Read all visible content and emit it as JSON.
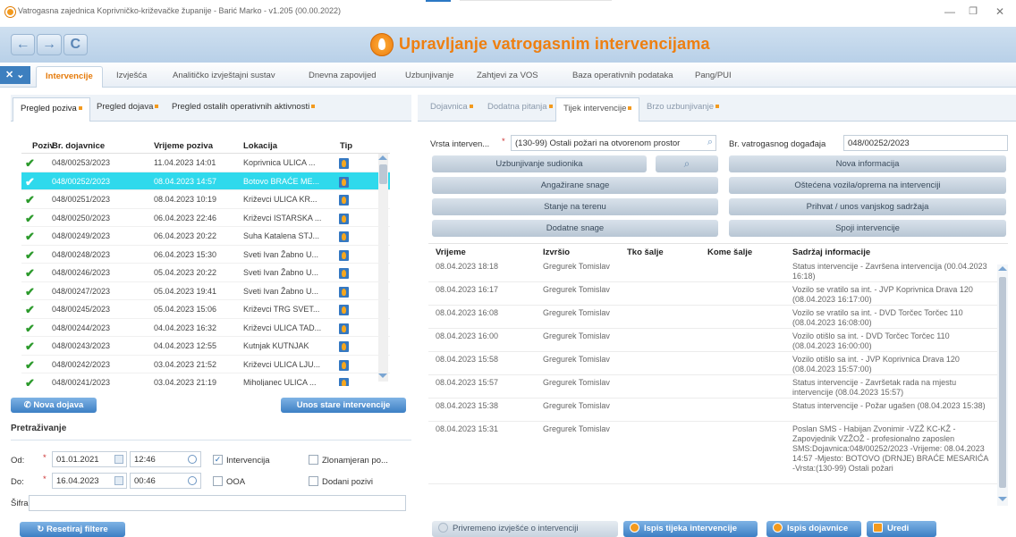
{
  "window": {
    "title": "Vatrogasna zajednica Koprivničko-križevačke županije - Barić Marko - v1.205 (00.00.2022)"
  },
  "header": {
    "app_title": "Upravljanje vatrogasnim intervencijama",
    "nav": [
      "←",
      "→",
      "C"
    ]
  },
  "menu": {
    "items": [
      "Intervencije",
      "Izvješća",
      "Analitičko izvještajni sustav",
      "Dnevna zapovijed",
      "Uzbunjivanje",
      "Zahtjevi za VOS",
      "Baza operativnih podataka",
      "Pang/PUI"
    ]
  },
  "left": {
    "tabs": [
      "Pregled poziva",
      "Pregled dojava",
      "Pregled ostalih operativnih aktivnosti"
    ],
    "columns": [
      "Poziv",
      "Br. dojavnice",
      "Vrijeme poziva",
      "Lokacija",
      "Tip"
    ],
    "rows": [
      {
        "broj": "048/00253/2023",
        "vrijeme": "11.04.2023 14:01",
        "lokacija": "Koprivnica ULICA ..."
      },
      {
        "broj": "048/00252/2023",
        "vrijeme": "08.04.2023 14:57",
        "lokacija": "Botovo BRAĆE ME..."
      },
      {
        "broj": "048/00251/2023",
        "vrijeme": "08.04.2023 10:19",
        "lokacija": "Križevci ULICA KR..."
      },
      {
        "broj": "048/00250/2023",
        "vrijeme": "06.04.2023 22:46",
        "lokacija": "Križevci ISTARSKA ..."
      },
      {
        "broj": "048/00249/2023",
        "vrijeme": "06.04.2023 20:22",
        "lokacija": "Suha Katalena STJ..."
      },
      {
        "broj": "048/00248/2023",
        "vrijeme": "06.04.2023 15:30",
        "lokacija": "Sveti Ivan Žabno U..."
      },
      {
        "broj": "048/00246/2023",
        "vrijeme": "05.04.2023 20:22",
        "lokacija": "Sveti Ivan Žabno U..."
      },
      {
        "broj": "048/00247/2023",
        "vrijeme": "05.04.2023 19:41",
        "lokacija": "Sveti Ivan Žabno U..."
      },
      {
        "broj": "048/00245/2023",
        "vrijeme": "05.04.2023 15:06",
        "lokacija": "Križevci TRG SVET..."
      },
      {
        "broj": "048/00244/2023",
        "vrijeme": "04.04.2023 16:32",
        "lokacija": "Križevci ULICA TAD..."
      },
      {
        "broj": "048/00243/2023",
        "vrijeme": "04.04.2023 12:55",
        "lokacija": "Kutnjak KUTNJAK"
      },
      {
        "broj": "048/00242/2023",
        "vrijeme": "03.04.2023 21:52",
        "lokacija": "Križevci ULICA LJU..."
      },
      {
        "broj": "048/00241/2023",
        "vrijeme": "03.04.2023 21:19",
        "lokacija": "Miholjanec ULICA ..."
      }
    ],
    "btn_nova_dojava": "Nova dojava",
    "btn_unos_stare": "Unos stare intervencije",
    "search_title": "Pretraživanje",
    "od_label": "Od:",
    "do_label": "Do:",
    "sifra_label": "Šifra",
    "od_date": "01.01.2021",
    "od_time": "12:46",
    "do_date": "16.04.2023",
    "do_time": "00:46",
    "cb_intervencija": "Intervencija",
    "cb_ooa": "OOA",
    "cb_zlonamjeran": "Zlonamjeran po...",
    "cb_dodani": "Dodani pozivi",
    "btn_reset": "Resetiraj filtere"
  },
  "right": {
    "tabs": [
      "Dojavnica",
      "Dodatna pitanja",
      "Tijek intervencije",
      "Brzo uzbunjivanje"
    ],
    "vrsta_label": "Vrsta interven...",
    "vrsta_value": "(130-99) Ostali požari na otvorenom prostor",
    "br_label": "Br. vatrogasnog događaja",
    "br_value": "048/00252/2023",
    "buttons_left": [
      "Uzbunjivanje sudionika",
      "Angažirane snage",
      "Stanje na terenu",
      "Dodatne snage"
    ],
    "buttons_right": [
      "Nova informacija",
      "Oštećena vozila/oprema na intervenciji",
      "Prihvat / unos vanjskog sadržaja",
      "Spoji intervencije"
    ],
    "columns": [
      "Vrijeme",
      "Izvršio",
      "Tko šalje",
      "Kome šalje",
      "Sadržaj informacije"
    ],
    "rows": [
      {
        "vrijeme": "08.04.2023 18:18",
        "izvrsio": "Gregurek Tomislav",
        "sadrzaj": "Status intervencije - Završena intervencija (00.04.2023 16:18)"
      },
      {
        "vrijeme": "08.04.2023 16:17",
        "izvrsio": "Gregurek Tomislav",
        "sadrzaj": "Vozilo se vratilo sa int. - JVP Koprivnica Drava 120 (08.04.2023 16:17:00)"
      },
      {
        "vrijeme": "08.04.2023 16:08",
        "izvrsio": "Gregurek Tomislav",
        "sadrzaj": "Vozilo se vratilo sa int. - DVD Torčec Torčec 110 (08.04.2023 16:08:00)"
      },
      {
        "vrijeme": "08.04.2023 16:00",
        "izvrsio": "Gregurek Tomislav",
        "sadrzaj": "Vozilo otišlo sa int. - DVD Torčec Torčec 110 (08.04.2023 16:00:00)"
      },
      {
        "vrijeme": "08.04.2023 15:58",
        "izvrsio": "Gregurek Tomislav",
        "sadrzaj": "Vozilo otišlo sa int. - JVP Koprivnica Drava 120 (08.04.2023 15:57:00)"
      },
      {
        "vrijeme": "08.04.2023 15:57",
        "izvrsio": "Gregurek Tomislav",
        "sadrzaj": "Status intervencije - Završetak rada na mjestu intervencije (08.04.2023 15:57)"
      },
      {
        "vrijeme": "08.04.2023 15:38",
        "izvrsio": "Gregurek Tomislav",
        "sadrzaj": "Status intervencije - Požar ugašen (08.04.2023 15:38)"
      },
      {
        "vrijeme": "08.04.2023 15:31",
        "izvrsio": "Gregurek Tomislav",
        "sadrzaj": "Poslan SMS - Habijan Zvonimir -VZŽ KC-KŽ - Zapovjednik VZŽOŽ - profesionalno zaposlen SMS:Dojavnica:048/00252/2023 -Vrijeme: 08.04.2023 14:57 -Mjesto: BOTOVO (DRNJE) BRAĆE MESARIĆA -Vrsta:(130-99) Ostali požari"
      }
    ],
    "bottom_buttons": [
      "Privremeno izvješće o intervenciji",
      "Ispis tijeka intervencije",
      "Ispis dojavnice",
      "Uredi"
    ]
  }
}
